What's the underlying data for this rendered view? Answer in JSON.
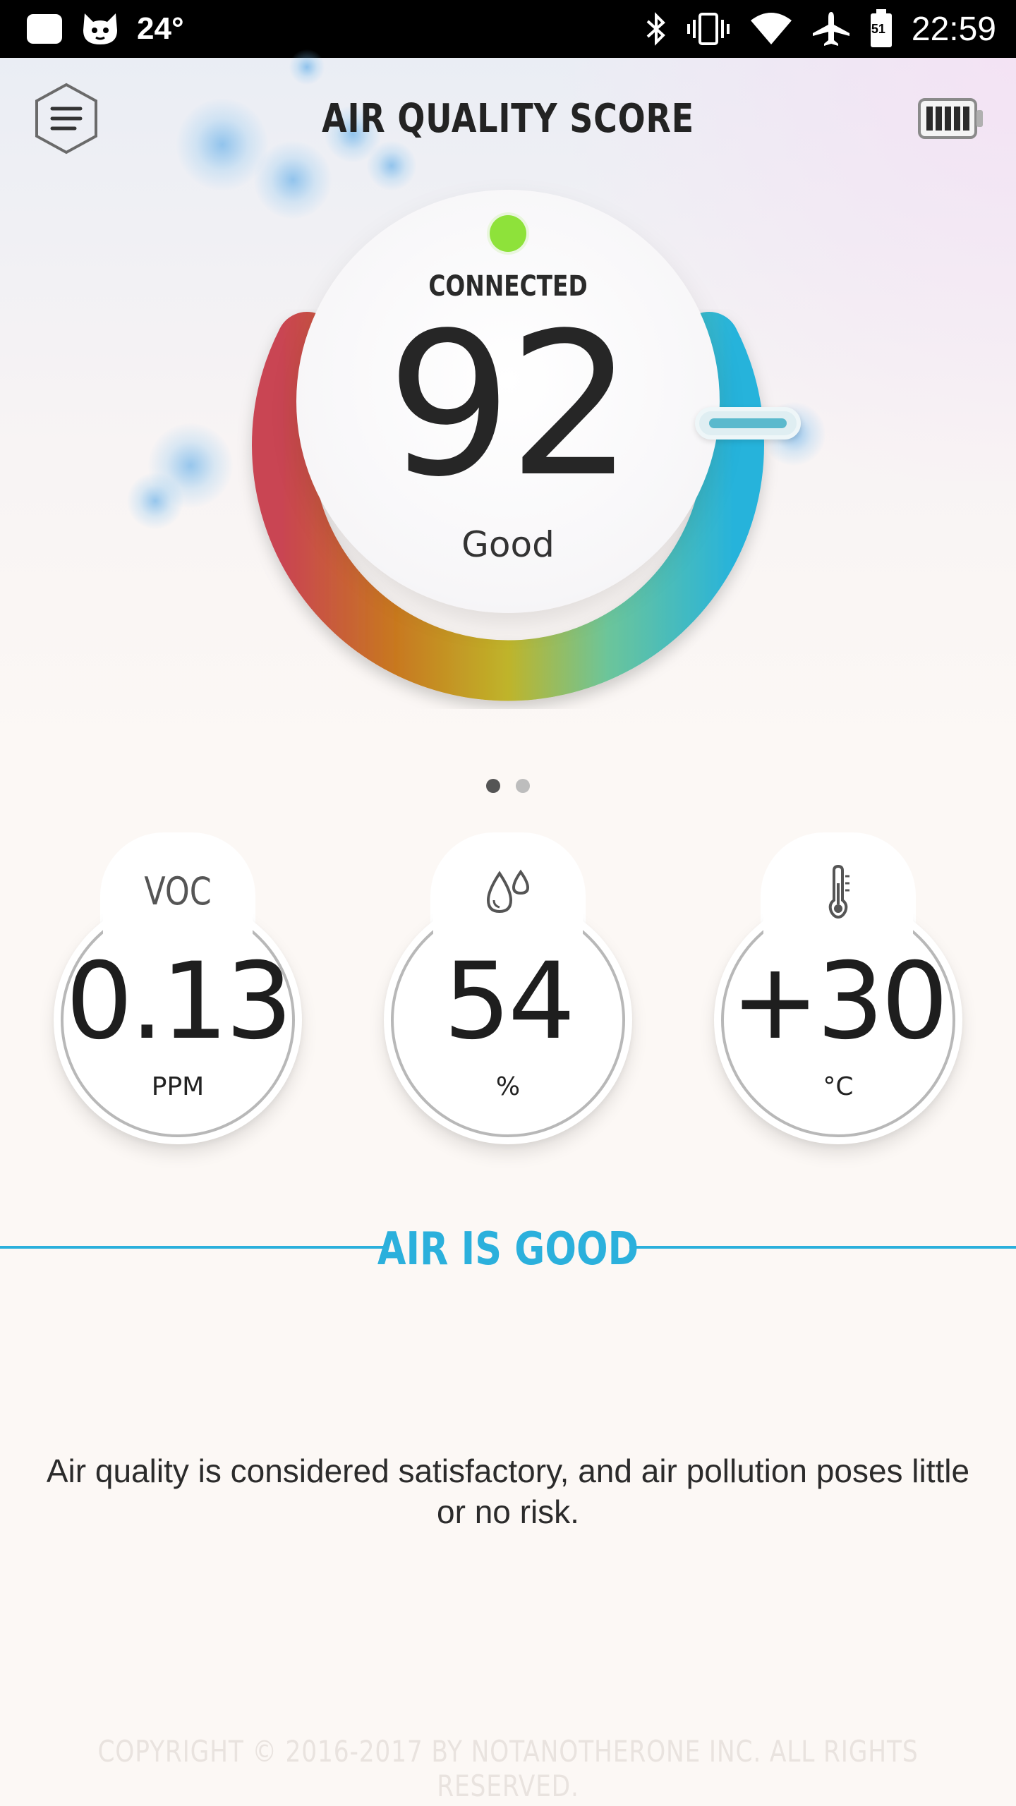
{
  "status_bar": {
    "temperature": "24°",
    "time": "22:59",
    "sim_label": "51",
    "icons": [
      "notification-icon",
      "cat-icon",
      "bluetooth-icon",
      "vibrate-icon",
      "wifi-icon",
      "airplane-icon",
      "battery-status-icon"
    ]
  },
  "header": {
    "title": "AIR QUALITY SCORE",
    "menu_icon": "hexagon-menu-icon",
    "battery_icon": "device-battery-icon"
  },
  "gauge": {
    "connection": "CONNECTED",
    "score": "92",
    "rating": "Good",
    "colors": [
      "#c94452",
      "#c8781f",
      "#bfb42a",
      "#6cc59a",
      "#27b3db"
    ],
    "connected_color": "#8ee23a"
  },
  "pager": {
    "count": 2,
    "active": 0
  },
  "metrics": [
    {
      "label": "VOC",
      "value": "0.13",
      "unit": "PPM",
      "icon": "voc-label"
    },
    {
      "label": "",
      "value": "54",
      "unit": "%",
      "icon": "humidity-drops-icon"
    },
    {
      "label": "",
      "value": "+30",
      "unit": "°C",
      "icon": "thermometer-icon"
    }
  ],
  "status": {
    "headline": "AIR IS GOOD",
    "description": "Air quality is considered satisfactory, and air pollution poses little or no risk.",
    "accent": "#2bb0dc"
  },
  "footer": {
    "copyright": "COPYRIGHT © 2016-2017 BY NOTANOTHERONE INC. ALL RIGHTS RESERVED."
  }
}
